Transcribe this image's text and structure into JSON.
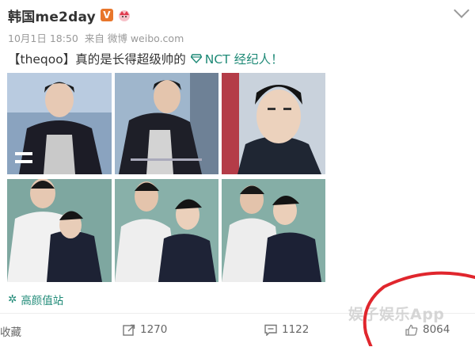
{
  "post": {
    "username": "韩国me2day",
    "verified_badge": "V",
    "timestamp": "10月1日 18:50",
    "source_prefix": "来自",
    "source": "微博 weibo.com",
    "text": "【theqoo】真的是长得超级帅的",
    "topic": "NCT 经纪人！",
    "location": "高颜值站"
  },
  "actions": {
    "favorite_label": "收藏",
    "repost_count": "1270",
    "comment_count": "1122",
    "like_count": "8064"
  },
  "overlay": {
    "watermark": "娱子娱乐App",
    "annotation_color": "#e0262d"
  },
  "colors": {
    "link": "#1f8a77",
    "badge": "#e8762b"
  }
}
